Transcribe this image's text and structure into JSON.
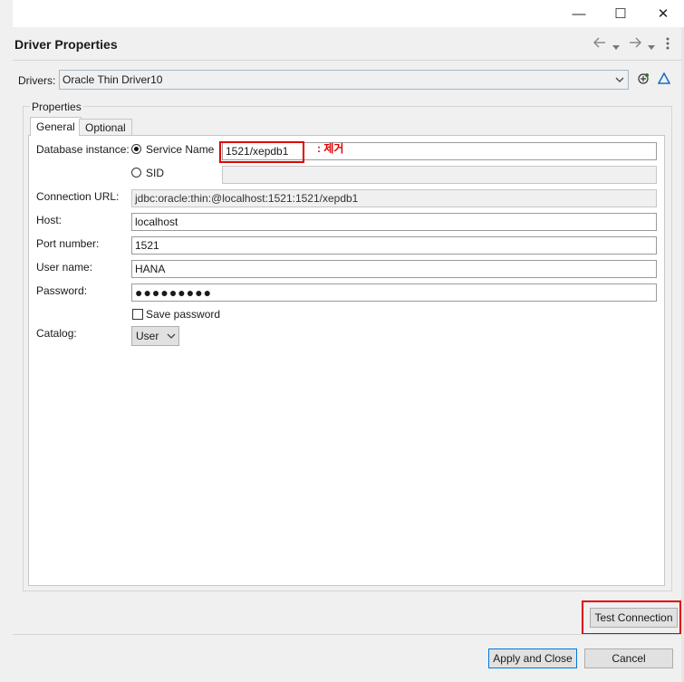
{
  "window": {
    "controls": {
      "minimize": "—",
      "maximize": "☐",
      "close": "✕"
    }
  },
  "header": {
    "title": "Driver Properties",
    "icons": [
      "back-icon",
      "back-dropdown-icon",
      "forward-icon",
      "forward-dropdown-icon",
      "more-icon"
    ]
  },
  "drivers": {
    "label": "Drivers:",
    "selected": "Oracle Thin Driver10",
    "icons": [
      "add-driver-icon",
      "edit-driver-icon"
    ]
  },
  "properties": {
    "legend": "Properties",
    "tabs": [
      {
        "label": "General",
        "active": true
      },
      {
        "label": "Optional",
        "active": false
      }
    ]
  },
  "form": {
    "database_instance_label": "Database instance:",
    "service_name_label": "Service Name",
    "service_name_value": "1521/xepdb1",
    "service_name_selected": true,
    "sid_label": "SID",
    "sid_value": "",
    "connection_url_label": "Connection URL:",
    "connection_url_value": "jdbc:oracle:thin:@localhost:1521:1521/xepdb1",
    "host_label": "Host:",
    "host_value": "localhost",
    "port_label": "Port number:",
    "port_value": "1521",
    "user_label": "User name:",
    "user_value": "HANA",
    "password_label": "Password:",
    "password_value": "●●●●●●●●●",
    "save_password_label": "Save password",
    "save_password_checked": false,
    "catalog_label": "Catalog:",
    "catalog_value": "User"
  },
  "annotation": {
    "text": ": 제거",
    "color": "#e00000"
  },
  "buttons": {
    "test_connection": "Test Connection",
    "apply_close": "Apply and Close",
    "cancel": "Cancel"
  },
  "colors": {
    "highlight_red": "#e00000",
    "default_button_border": "#0078d7"
  }
}
